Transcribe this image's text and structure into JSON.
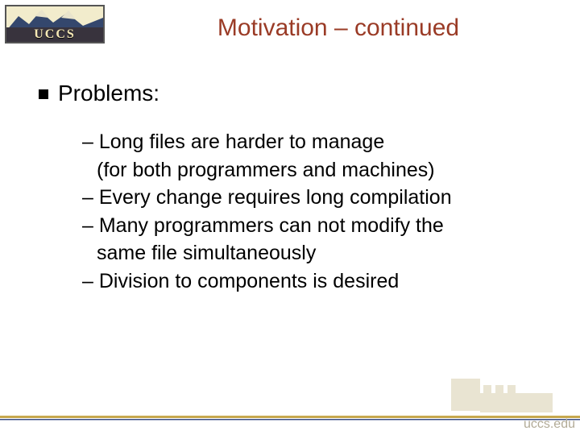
{
  "logo": {
    "text": "UCCS"
  },
  "title": "Motivation – continued",
  "heading": "Problems:",
  "items": [
    {
      "line1": "– Long files are harder to manage",
      "line2": "(for both programmers and machines)"
    },
    {
      "line1": "– Every change requires long compilation"
    },
    {
      "line1": "– Many programmers can not modify the",
      "line2": "same file simultaneously"
    },
    {
      "line1": "– Division to components is desired"
    }
  ],
  "footer": {
    "url": "uccs.edu"
  }
}
